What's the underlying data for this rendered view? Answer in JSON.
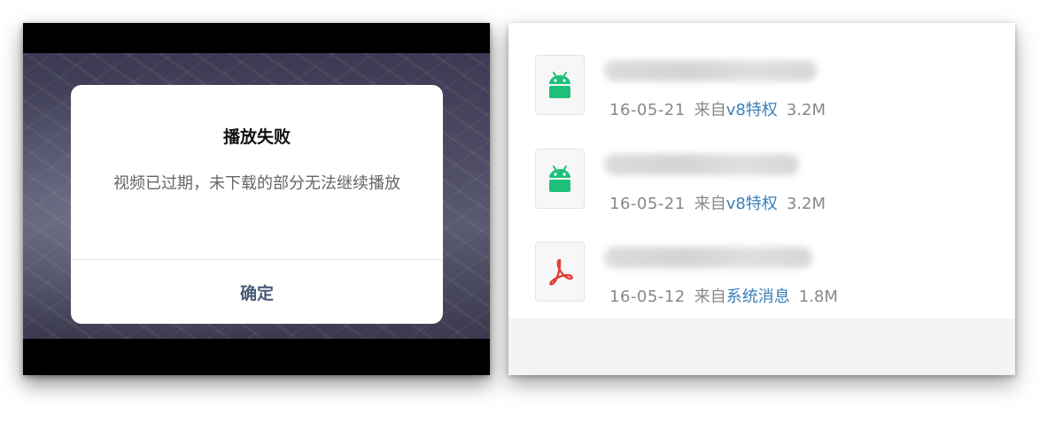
{
  "dialog": {
    "title": "播放失败",
    "message": "视频已过期，未下载的部分无法继续播放",
    "confirm_label": "确定"
  },
  "files": [
    {
      "icon": "android-icon",
      "date": "16-05-21",
      "from_prefix": "来自",
      "source": "v8特权",
      "size": "3.2M"
    },
    {
      "icon": "android-icon",
      "date": "16-05-21",
      "from_prefix": "来自",
      "source": "v8特权",
      "size": "3.2M"
    },
    {
      "icon": "pdf-icon",
      "date": "16-05-12",
      "from_prefix": "来自",
      "source": "系统消息",
      "size": "1.8M"
    }
  ],
  "colors": {
    "android_green": "#1fbf7a",
    "pdf_red": "#e0403a",
    "link_blue": "#3b7fb8",
    "dialog_button": "#4a5a78"
  }
}
